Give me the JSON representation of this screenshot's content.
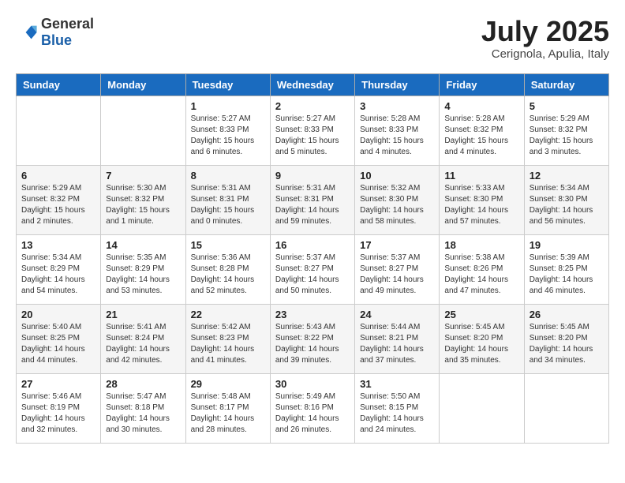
{
  "header": {
    "logo_general": "General",
    "logo_blue": "Blue",
    "month_title": "July 2025",
    "location": "Cerignola, Apulia, Italy"
  },
  "weekdays": [
    "Sunday",
    "Monday",
    "Tuesday",
    "Wednesday",
    "Thursday",
    "Friday",
    "Saturday"
  ],
  "weeks": [
    [
      {
        "day": "",
        "info": ""
      },
      {
        "day": "",
        "info": ""
      },
      {
        "day": "1",
        "info": "Sunrise: 5:27 AM\nSunset: 8:33 PM\nDaylight: 15 hours and 6 minutes."
      },
      {
        "day": "2",
        "info": "Sunrise: 5:27 AM\nSunset: 8:33 PM\nDaylight: 15 hours and 5 minutes."
      },
      {
        "day": "3",
        "info": "Sunrise: 5:28 AM\nSunset: 8:33 PM\nDaylight: 15 hours and 4 minutes."
      },
      {
        "day": "4",
        "info": "Sunrise: 5:28 AM\nSunset: 8:32 PM\nDaylight: 15 hours and 4 minutes."
      },
      {
        "day": "5",
        "info": "Sunrise: 5:29 AM\nSunset: 8:32 PM\nDaylight: 15 hours and 3 minutes."
      }
    ],
    [
      {
        "day": "6",
        "info": "Sunrise: 5:29 AM\nSunset: 8:32 PM\nDaylight: 15 hours and 2 minutes."
      },
      {
        "day": "7",
        "info": "Sunrise: 5:30 AM\nSunset: 8:32 PM\nDaylight: 15 hours and 1 minute."
      },
      {
        "day": "8",
        "info": "Sunrise: 5:31 AM\nSunset: 8:31 PM\nDaylight: 15 hours and 0 minutes."
      },
      {
        "day": "9",
        "info": "Sunrise: 5:31 AM\nSunset: 8:31 PM\nDaylight: 14 hours and 59 minutes."
      },
      {
        "day": "10",
        "info": "Sunrise: 5:32 AM\nSunset: 8:30 PM\nDaylight: 14 hours and 58 minutes."
      },
      {
        "day": "11",
        "info": "Sunrise: 5:33 AM\nSunset: 8:30 PM\nDaylight: 14 hours and 57 minutes."
      },
      {
        "day": "12",
        "info": "Sunrise: 5:34 AM\nSunset: 8:30 PM\nDaylight: 14 hours and 56 minutes."
      }
    ],
    [
      {
        "day": "13",
        "info": "Sunrise: 5:34 AM\nSunset: 8:29 PM\nDaylight: 14 hours and 54 minutes."
      },
      {
        "day": "14",
        "info": "Sunrise: 5:35 AM\nSunset: 8:29 PM\nDaylight: 14 hours and 53 minutes."
      },
      {
        "day": "15",
        "info": "Sunrise: 5:36 AM\nSunset: 8:28 PM\nDaylight: 14 hours and 52 minutes."
      },
      {
        "day": "16",
        "info": "Sunrise: 5:37 AM\nSunset: 8:27 PM\nDaylight: 14 hours and 50 minutes."
      },
      {
        "day": "17",
        "info": "Sunrise: 5:37 AM\nSunset: 8:27 PM\nDaylight: 14 hours and 49 minutes."
      },
      {
        "day": "18",
        "info": "Sunrise: 5:38 AM\nSunset: 8:26 PM\nDaylight: 14 hours and 47 minutes."
      },
      {
        "day": "19",
        "info": "Sunrise: 5:39 AM\nSunset: 8:25 PM\nDaylight: 14 hours and 46 minutes."
      }
    ],
    [
      {
        "day": "20",
        "info": "Sunrise: 5:40 AM\nSunset: 8:25 PM\nDaylight: 14 hours and 44 minutes."
      },
      {
        "day": "21",
        "info": "Sunrise: 5:41 AM\nSunset: 8:24 PM\nDaylight: 14 hours and 42 minutes."
      },
      {
        "day": "22",
        "info": "Sunrise: 5:42 AM\nSunset: 8:23 PM\nDaylight: 14 hours and 41 minutes."
      },
      {
        "day": "23",
        "info": "Sunrise: 5:43 AM\nSunset: 8:22 PM\nDaylight: 14 hours and 39 minutes."
      },
      {
        "day": "24",
        "info": "Sunrise: 5:44 AM\nSunset: 8:21 PM\nDaylight: 14 hours and 37 minutes."
      },
      {
        "day": "25",
        "info": "Sunrise: 5:45 AM\nSunset: 8:20 PM\nDaylight: 14 hours and 35 minutes."
      },
      {
        "day": "26",
        "info": "Sunrise: 5:45 AM\nSunset: 8:20 PM\nDaylight: 14 hours and 34 minutes."
      }
    ],
    [
      {
        "day": "27",
        "info": "Sunrise: 5:46 AM\nSunset: 8:19 PM\nDaylight: 14 hours and 32 minutes."
      },
      {
        "day": "28",
        "info": "Sunrise: 5:47 AM\nSunset: 8:18 PM\nDaylight: 14 hours and 30 minutes."
      },
      {
        "day": "29",
        "info": "Sunrise: 5:48 AM\nSunset: 8:17 PM\nDaylight: 14 hours and 28 minutes."
      },
      {
        "day": "30",
        "info": "Sunrise: 5:49 AM\nSunset: 8:16 PM\nDaylight: 14 hours and 26 minutes."
      },
      {
        "day": "31",
        "info": "Sunrise: 5:50 AM\nSunset: 8:15 PM\nDaylight: 14 hours and 24 minutes."
      },
      {
        "day": "",
        "info": ""
      },
      {
        "day": "",
        "info": ""
      }
    ]
  ]
}
